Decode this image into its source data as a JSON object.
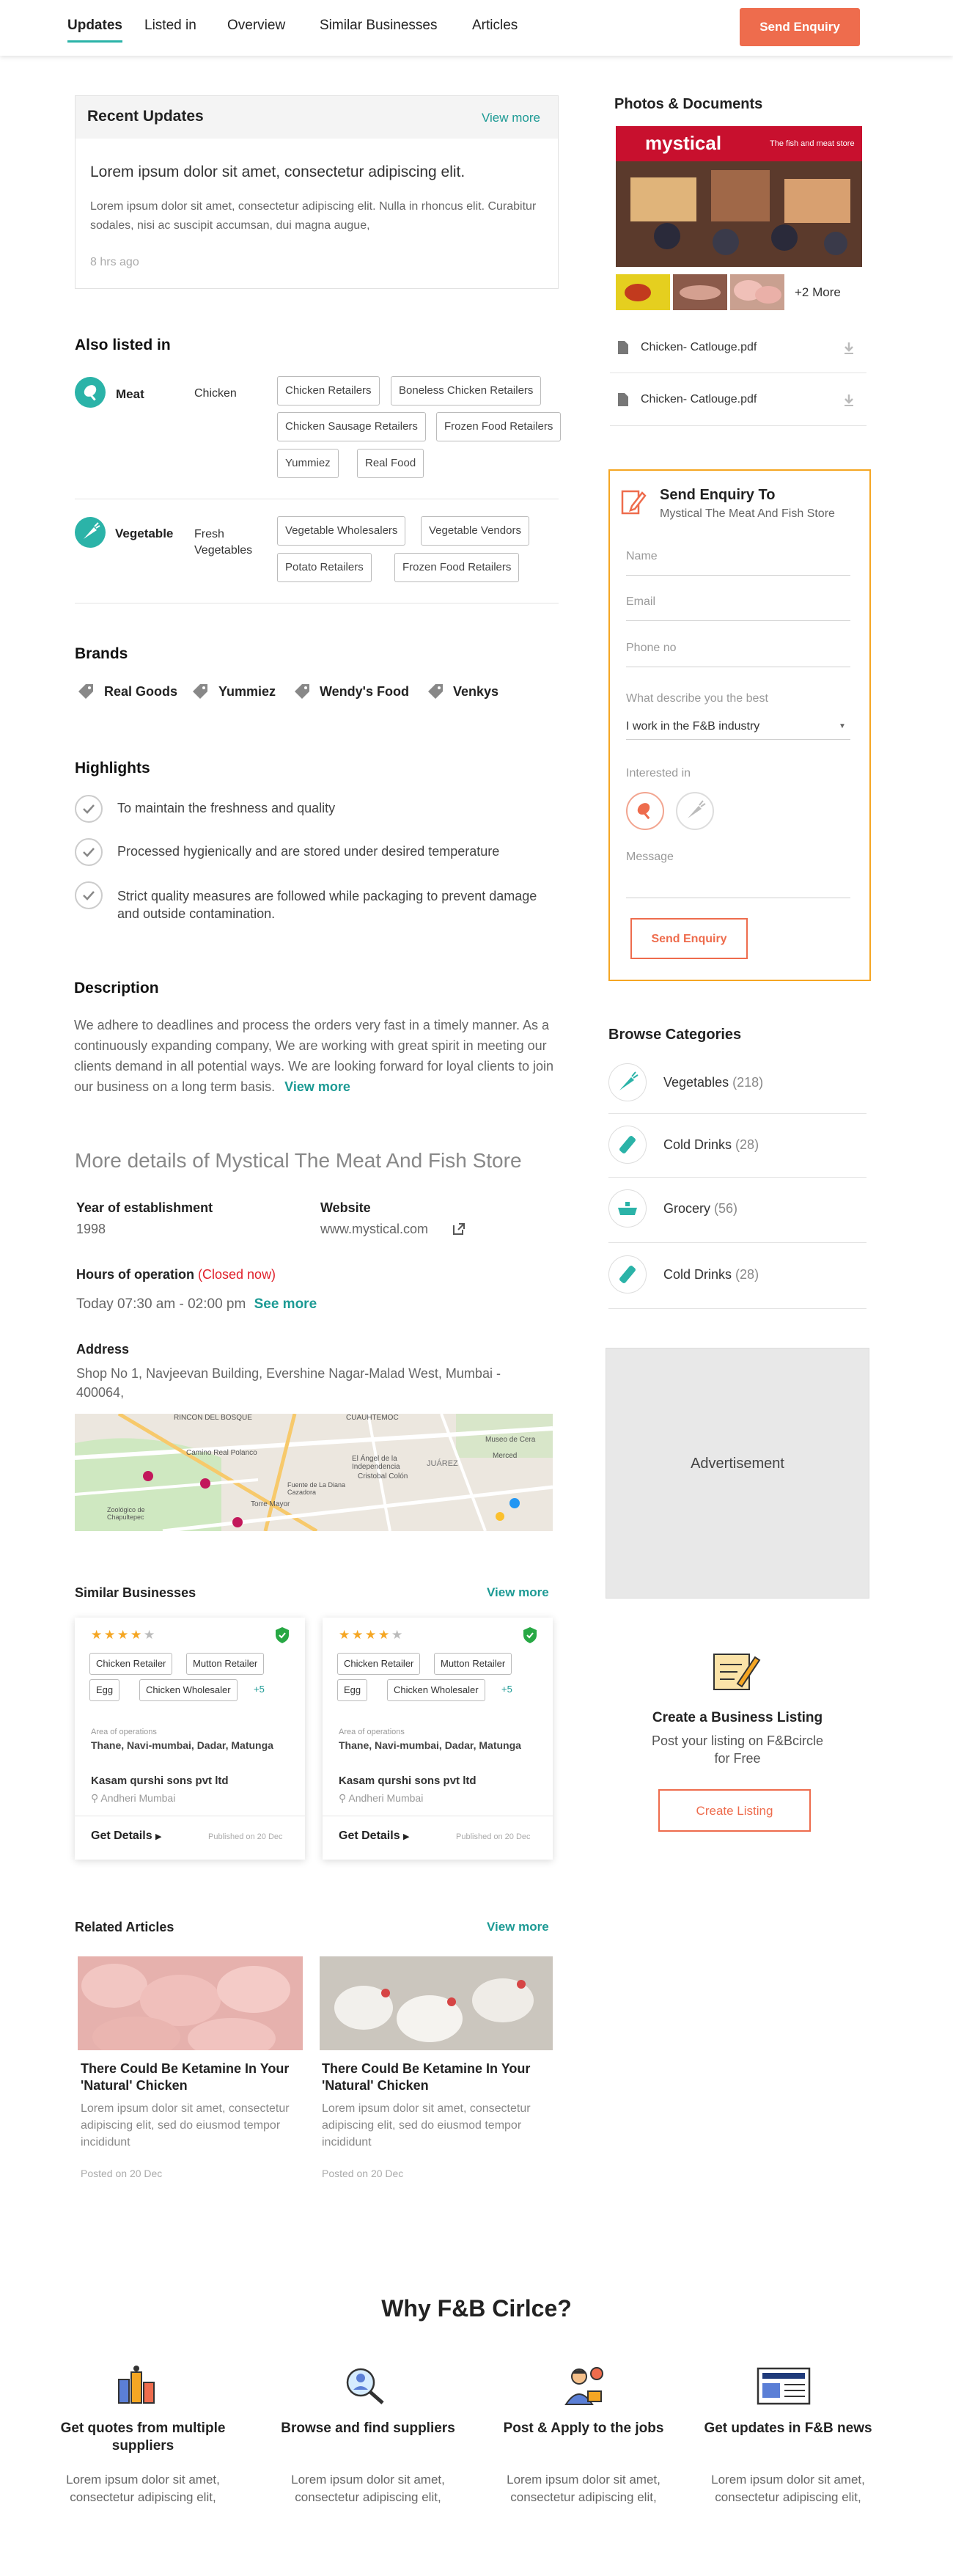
{
  "nav": {
    "tabs": [
      "Updates",
      "Listed in",
      "Overview",
      "Similar Businesses",
      "Articles"
    ],
    "send_enquiry": "Send Enquiry"
  },
  "recent_updates": {
    "title": "Recent Updates",
    "view_more": "View more",
    "headline": "Lorem ipsum dolor sit amet, consectetur adipiscing elit.",
    "body": "Lorem ipsum dolor sit amet, consectetur adipiscing elit. Nulla in rhoncus elit. Curabitur sodales, nisi ac suscipit accumsan, dui magna augue,",
    "time": "8 hrs ago"
  },
  "also_listed": {
    "title": "Also listed in",
    "groups": [
      {
        "name": "Meat",
        "sub": "Chicken",
        "tags": [
          "Chicken Retailers",
          "Boneless Chicken Retailers",
          "Chicken Sausage Retailers",
          "Frozen Food Retailers",
          "Yummiez",
          "Real Food"
        ]
      },
      {
        "name": "Vegetable",
        "sub": "Fresh Vegetables",
        "tags": [
          "Vegetable Wholesalers",
          "Vegetable Vendors",
          "Potato Retailers",
          "Frozen Food Retailers"
        ]
      }
    ]
  },
  "brands": {
    "title": "Brands",
    "items": [
      "Real Goods",
      "Yummiez",
      "Wendy's Food",
      "Venkys"
    ]
  },
  "highlights": {
    "title": "Highlights",
    "items": [
      "To maintain the freshness and quality",
      "Processed hygienically and are stored under desired temperature",
      "Strict quality measures are followed while packaging to prevent damage and outside contamination."
    ]
  },
  "description": {
    "title": "Description",
    "text": "We adhere to deadlines and process the orders very fast in a timely manner. As a continuously expanding company, We are working with great spirit in meeting our clients demand in all potential ways. We are looking forward for loyal clients to join our business on a long term basis.",
    "view_more": "View more"
  },
  "details": {
    "title": "More details of Mystical The Meat And Fish Store",
    "year_label": "Year of establishment",
    "year_value": "1998",
    "website_label": "Website",
    "website_value": "www.mystical.com",
    "hours_label": "Hours of operation",
    "hours_status": "(Closed now)",
    "hours_value": "Today 07:30 am - 02:00 pm",
    "see_more": "See more",
    "address_label": "Address",
    "address_value": "Shop No 1, Navjeevan Building, Evershine Nagar-Malad West, Mumbai - 400064,",
    "map_labels": [
      "RINCON DEL BOSQUE",
      "CUAUHTEMOC",
      "Camino Real Polanco",
      "El Ángel de la Independencia",
      "Cristobal Colón",
      "JUÁREZ",
      "Museo de Cera",
      "Torre Mayor",
      "Fuente de La Diana Cazadora",
      "Zoológico de Chapultepec",
      "Merced"
    ]
  },
  "similar": {
    "title": "Similar Businesses",
    "view_more": "View more",
    "cards": [
      {
        "tags": [
          "Chicken Retailer",
          "Mutton Retailer",
          "Egg",
          "Chicken Wholesaler"
        ],
        "more": "+5",
        "area_label": "Area of operations",
        "area": "Thane, Navi-mumbai, Dadar, Matunga",
        "name": "Kasam qurshi sons pvt ltd",
        "location": "Andheri Mumbai",
        "get_details": "Get Details",
        "published": "Published on 20 Dec",
        "stars": 4
      },
      {
        "tags": [
          "Chicken Retailer",
          "Mutton Retailer",
          "Egg",
          "Chicken Wholesaler"
        ],
        "more": "+5",
        "area_label": "Area of operations",
        "area": "Thane, Navi-mumbai, Dadar, Matunga",
        "name": "Kasam qurshi sons pvt ltd",
        "location": "Andheri Mumbai",
        "get_details": "Get Details",
        "published": "Published on 20 Dec",
        "stars": 4
      }
    ]
  },
  "articles": {
    "title": "Related Articles",
    "view_more": "View more",
    "items": [
      {
        "title": "There Could Be Ketamine In Your 'Natural' Chicken",
        "excerpt": "Lorem ipsum dolor sit amet, consectetur adipiscing elit, sed do eiusmod tempor incididunt",
        "date": "Posted on 20 Dec"
      },
      {
        "title": "There Could Be Ketamine In Your 'Natural' Chicken",
        "excerpt": "Lorem ipsum dolor sit amet, consectetur adipiscing elit, sed do eiusmod tempor incididunt",
        "date": "Posted on 20 Dec"
      }
    ]
  },
  "photos": {
    "title": "Photos & Documents",
    "sign_text": "mystical",
    "sign_sub": "The fish and meat store",
    "more": "+2 More",
    "docs": [
      "Chicken- Catlouge.pdf",
      "Chicken- Catlouge.pdf"
    ]
  },
  "enquiry": {
    "title": "Send Enquiry To",
    "subtitle": "Mystical The Meat And Fish Store",
    "name_ph": "Name",
    "email_ph": "Email",
    "phone_ph": "Phone no",
    "describe_label": "What describe you the best",
    "describe_value": "I work in the F&B industry",
    "interested_label": "Interested in",
    "message_ph": "Message",
    "button": "Send Enquiry",
    "accent": "#f5a623"
  },
  "browse": {
    "title": "Browse Categories",
    "items": [
      {
        "label": "Vegetables",
        "count": "(218)"
      },
      {
        "label": "Cold Drinks",
        "count": "(28)"
      },
      {
        "label": "Grocery",
        "count": "(56)"
      },
      {
        "label": "Cold Drinks",
        "count": "(28)"
      }
    ]
  },
  "advert": {
    "label": "Advertisement"
  },
  "create_listing": {
    "title": "Create a Business Listing",
    "text": "Post your listing on F&Bcircle for Free",
    "button": "Create Listing"
  },
  "why": {
    "title": "Why F&B Cirlce?",
    "items": [
      {
        "title": "Get quotes from multiple suppliers",
        "text": "Lorem ipsum dolor sit amet, consectetur adipiscing elit,"
      },
      {
        "title": "Browse and find suppliers",
        "text": "Lorem ipsum dolor sit amet, consectetur adipiscing elit,"
      },
      {
        "title": "Post & Apply to the jobs",
        "text": "Lorem ipsum dolor sit amet, consectetur adipiscing elit,"
      },
      {
        "title": "Get updates in F&B news",
        "text": "Lorem ipsum dolor sit amet, consectetur adipiscing elit,"
      }
    ]
  },
  "colors": {
    "primary": "#ee6c4d",
    "teal": "#2bb3a8",
    "closed": "#e0202a",
    "star": "#f5a623",
    "verified": "#27a844"
  }
}
